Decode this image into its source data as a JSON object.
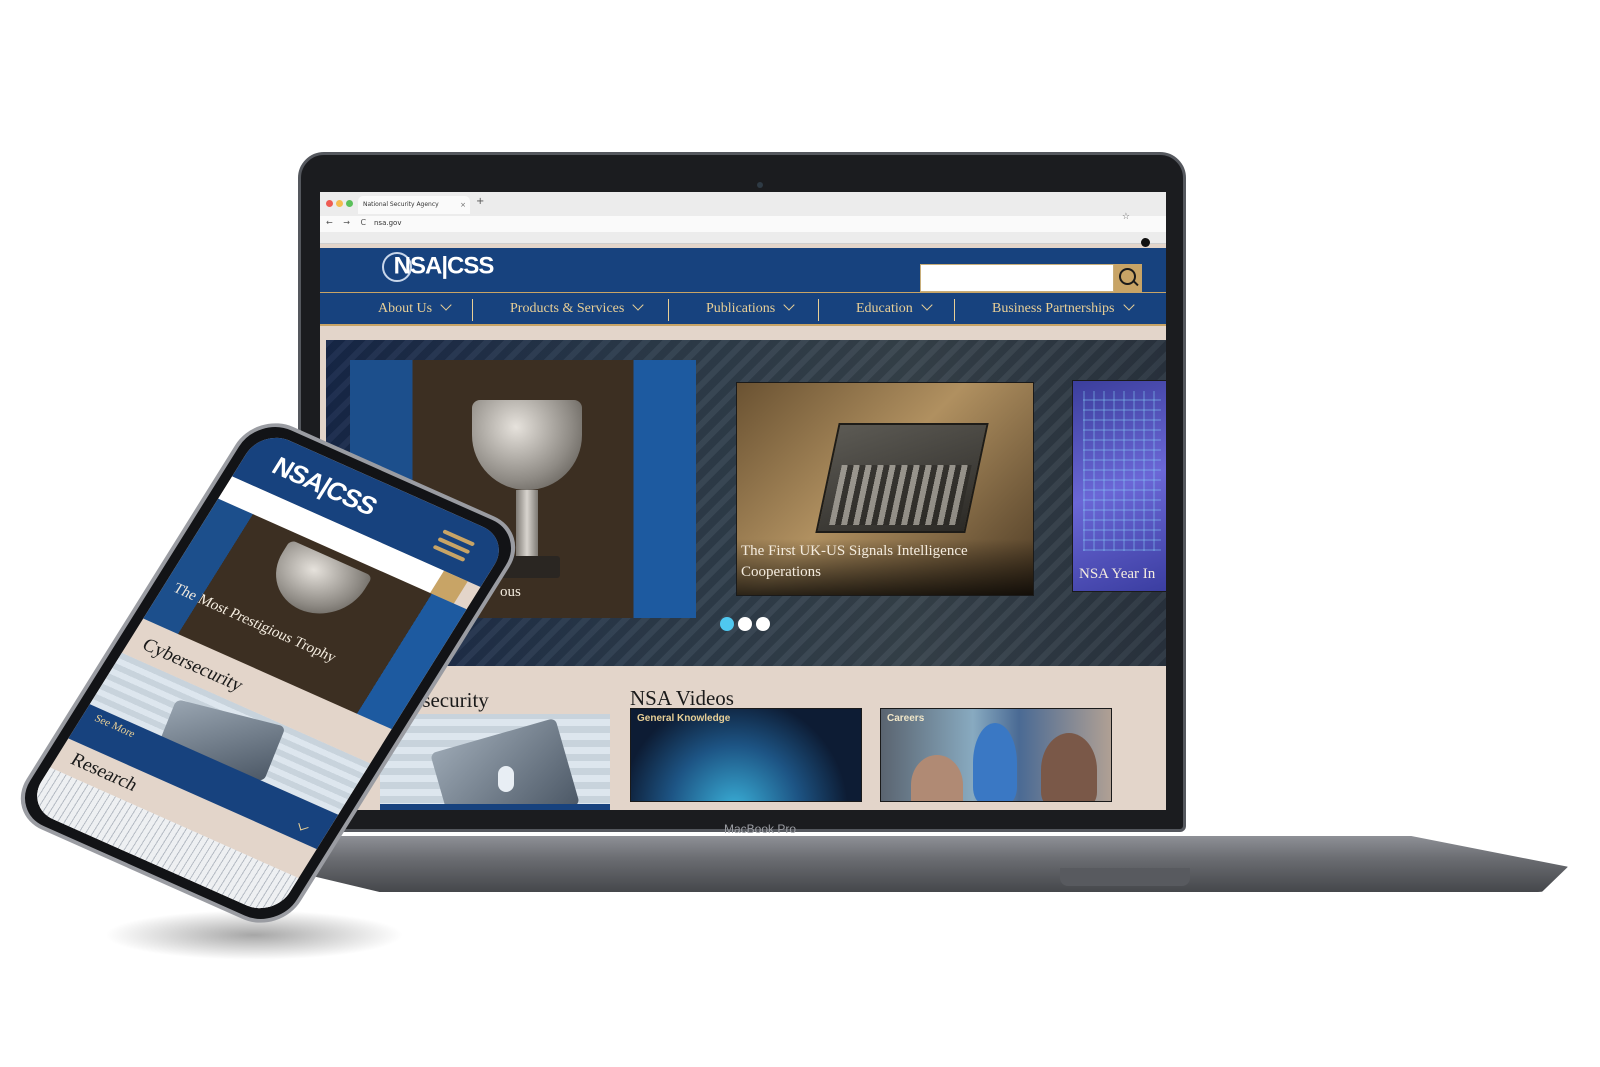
{
  "browser": {
    "tab_title": "National Security Agency",
    "tab_close": "×",
    "new_tab": "+",
    "nav_arrows": "← → C",
    "url": "nsa.gov",
    "star_icon": "☆"
  },
  "site": {
    "logo": "NSA|CSS",
    "search_placeholder": "",
    "nav": [
      {
        "label": "About Us"
      },
      {
        "label": "Products & Services"
      },
      {
        "label": "Publications"
      },
      {
        "label": "Education"
      },
      {
        "label": "Business Partnerships"
      }
    ]
  },
  "carousel": {
    "slides": [
      {
        "caption": "ous"
      },
      {
        "caption": "The First UK-US Signals Intelligence Cooperations"
      },
      {
        "caption": "NSA Year In"
      }
    ],
    "dots": 3,
    "active_dot": 0
  },
  "sections": {
    "cybersecurity_title": "ersecurity",
    "videos_title": "NSA Videos",
    "videos": [
      {
        "label": "General Knowledge"
      },
      {
        "label": "Careers"
      }
    ]
  },
  "laptop": {
    "brand": "MacBook Pro"
  },
  "phone": {
    "logo": "NSA|CSS",
    "hero_caption": "The Most Prestigious Trophy",
    "cybersecurity_title": "Cybersecurity",
    "see_more": "See More",
    "research_title": "Research"
  },
  "colors": {
    "nsa_blue": "#17427e",
    "gold": "#c8a466",
    "page_bg": "#e3d5ca",
    "carousel_active": "#4fc8f0"
  }
}
